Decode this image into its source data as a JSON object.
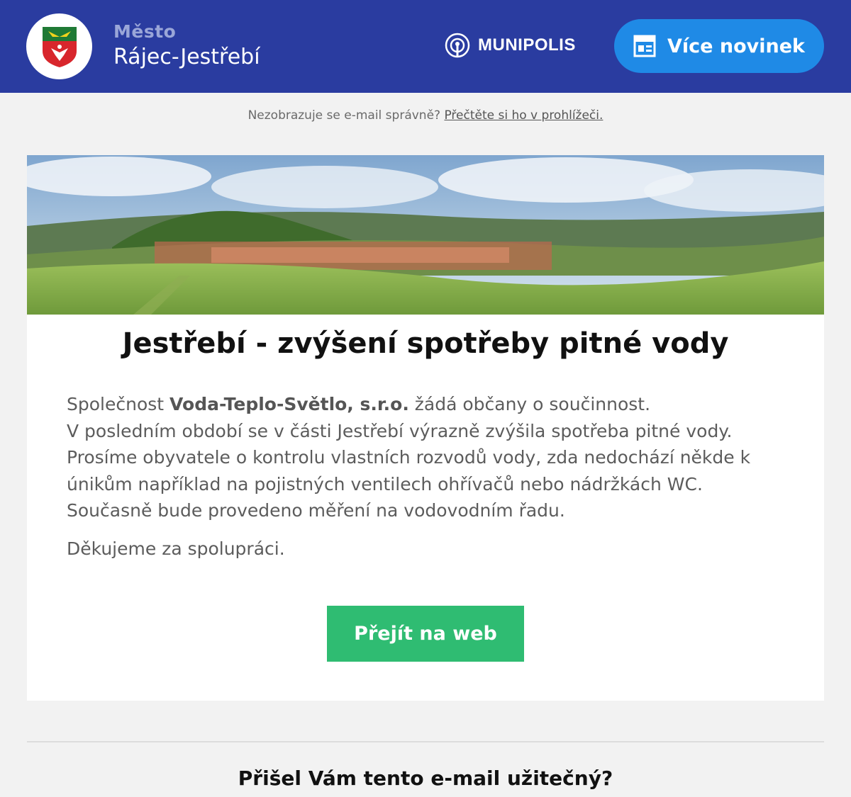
{
  "header": {
    "city_prefix": "Město",
    "city_name": "Rájec-Jestřebí",
    "brand": "MUNIPOLIS",
    "more_news": "Více novinek"
  },
  "notice": {
    "text": "Nezobrazuje se e-mail správně?",
    "link": "Přečtěte si ho v prohlížeči."
  },
  "article": {
    "title": "Jestřebí - zvýšení spotřeby pitné vody",
    "intro_pre": "Společnost ",
    "company": "Voda-Teplo-Světlo, s.r.o.",
    "intro_post": " žádá občany o součinnost.",
    "line2": "V posledním období se v  části Jestřebí výrazně zvýšila spotřeba pitné vody.",
    "line3": "Prosíme obyvatele o kontrolu vlastních rozvodů vody, zda nedochází někde k únikům například na pojistných ventilech ohřívačů nebo nádržkách WC.",
    "line4": "Současně bude provedeno měření na vodovodním řadu.",
    "thanks": "Děkujeme za spolupráci.",
    "cta": "Přejít na web"
  },
  "footer": {
    "question": "Přišel Vám tento e-mail užitečný?"
  },
  "colors": {
    "header_bg": "#2a3ca0",
    "more_btn": "#1f8ae6",
    "cta_btn": "#2fbc72"
  },
  "icons": [
    "coat-of-arms-icon",
    "munipolis-logo-icon",
    "newspaper-icon"
  ]
}
